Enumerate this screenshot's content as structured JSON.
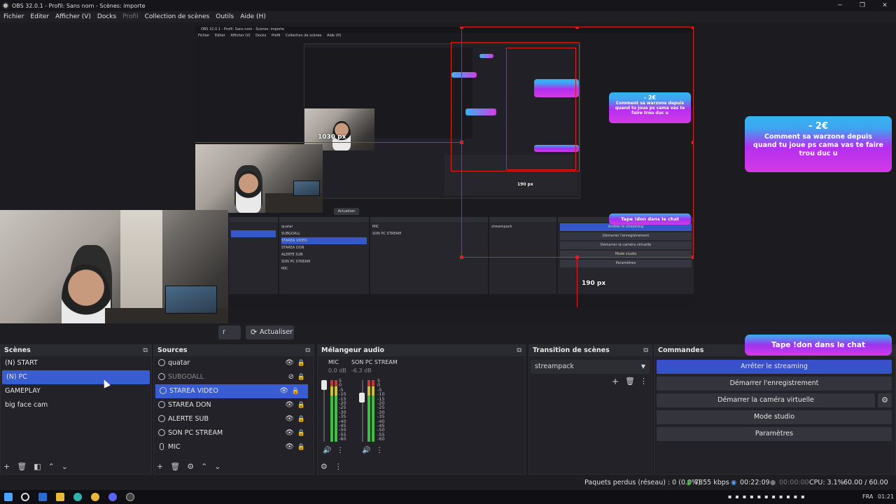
{
  "window": {
    "title": "OBS 32.0.1 - Profil: Sans nom - Scènes: importe",
    "controls": [
      "─",
      "❐",
      "✕"
    ]
  },
  "menu": [
    "Fichier",
    "Editer",
    "Afficher (V)",
    "Docks",
    "Profil",
    "Collection de scènes",
    "Outils",
    "Aide (H)"
  ],
  "preview": {
    "nested_title": "OBS 32.0.1 - Profil: Sans nom - Scènes: importe",
    "nested_menu": [
      "Fichier",
      "Editer",
      "Afficher (V)",
      "Docks",
      "Profil",
      "Collection de scènes",
      "Aide (H)"
    ],
    "px_top": "1030 px",
    "px_mid": "190 px",
    "px_bottom": "190 px",
    "mini_actualiser": "Actualiser"
  },
  "alerts": {
    "big_amount": "- 2€",
    "big_message": "Comment sa warzone depuis quand tu joue ps cama vas te faire trou duc u",
    "mini_amount": "- 2€",
    "mini_message": "Comment sa warzone depuis quand tu joue ps cama vas te faire trou duc u",
    "pill_big": "Tape !don dans le chat",
    "pill_mini": "Tape !don dans le chat"
  },
  "actualiser": {
    "left_label": "r",
    "label": "Actualiser"
  },
  "scenes": {
    "title": "Scènes",
    "items": [
      "(N) START",
      "(N) PC",
      "GAMEPLAY",
      "big face cam"
    ],
    "selected": "(N) PC"
  },
  "sources": {
    "title": "Sources",
    "items": [
      "quatar",
      "SUBGOALL",
      "STAREA VIDEO",
      "STAREA DON",
      "ALERTE SUB",
      "SON PC STREAM",
      "MIC"
    ]
  },
  "mixer": {
    "title": "Mélangeur audio",
    "channels": [
      {
        "name": "MIC",
        "db": "0.0 dB"
      },
      {
        "name": "SON PC STREAM",
        "db": "-6.3 dB"
      }
    ],
    "ticks": "5\n0\n-5\n-10\n-15\n-20\n-25\n-30\n-35\n-40\n-45\n-50\n-55\n-60"
  },
  "transition": {
    "title": "Transition de scènes",
    "selected": "streampack"
  },
  "commands": {
    "title": "Commandes",
    "buttons": [
      "Arrêter le streaming",
      "Démarrer l'enregistrement",
      "Démarrer la caméra virtuelle",
      "Mode studio",
      "Paramètres"
    ]
  },
  "status": {
    "dropped": "Paquets perdus (réseau) : 0 (0.0%)",
    "bitrate": "7855 kbps",
    "stream_time": "00:22:09",
    "rec_time": "00:00:00",
    "cpu": "CPU: 3.1%",
    "fps": "60.00 / 60.00 FPS"
  },
  "taskbar": {
    "lang": "FRA",
    "clock": "01:21"
  },
  "colors": {
    "accent": "#3a5cd3",
    "alert_red": "#e01d1d",
    "pink": "#d43ae6",
    "cyan": "#36b4ef"
  }
}
